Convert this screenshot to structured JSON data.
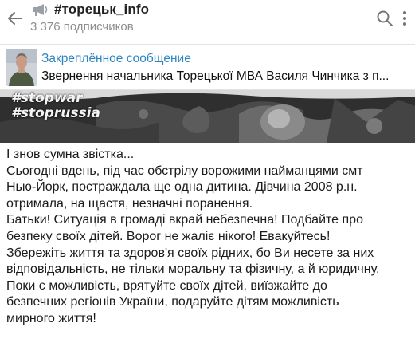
{
  "header": {
    "channel_name": "#торецьк_info",
    "subscribers": "3 376 подписчиков",
    "back_icon": "arrow-left-icon",
    "megaphone_icon": "megaphone-icon",
    "search_icon": "search-icon",
    "menu_icon": "kebab-menu-icon"
  },
  "pinned": {
    "label": "Закреплённое сообщение",
    "text": "Звернення начальника Торецької МВА Василя Чинчика з п..."
  },
  "banner": {
    "tags": [
      "#stopwar",
      "#stoprussia"
    ]
  },
  "message": {
    "lines": [
      "І знов сумна звістка...",
      "Сьогодні вдень, під час обстрілу ворожими найманцями смт",
      "Нью-Йорк, постраждала ще одна дитина. Дівчина 2008 р.н.",
      "отримала, на щастя, незначні поранення.",
      "Батьки! Ситуація в громаді вкрай небезпечна! Подбайте про",
      "безпеку своїх дітей. Ворог не жаліє нікого! Евакуйтесь!",
      "Збережіть життя та здоров'я своїх рідних, бо Ви несете за них",
      "відповідальність, не тільки моральну та фізичну, а й юридичну.",
      "Поки є можливість, врятуйте своїх дітей, виїзжайте до",
      "безпечних регіонів України, подаруйте дітям можливість",
      "мирного життя!"
    ]
  },
  "colors": {
    "accent": "#2e86c1",
    "muted": "#8e8e93"
  }
}
